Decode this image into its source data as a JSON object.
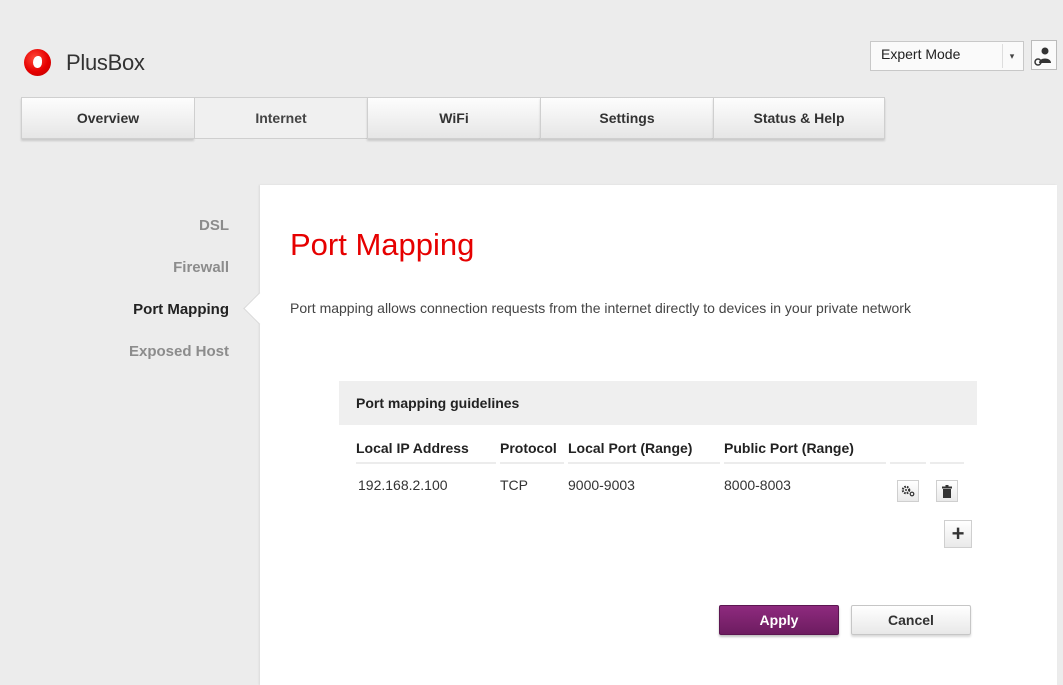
{
  "brand": {
    "name": "PlusBox",
    "accent": "#e60000"
  },
  "header": {
    "mode_select": {
      "value": "Expert Mode",
      "icon": "chevron-down-icon"
    },
    "user_button_icon": "user-icon"
  },
  "tabs": [
    {
      "label": "Overview",
      "active": false
    },
    {
      "label": "Internet",
      "active": true
    },
    {
      "label": "WiFi",
      "active": false
    },
    {
      "label": "Settings",
      "active": false
    },
    {
      "label": "Status & Help",
      "active": false
    }
  ],
  "subnav": [
    {
      "label": "DSL",
      "active": false
    },
    {
      "label": "Firewall",
      "active": false
    },
    {
      "label": "Port Mapping",
      "active": true
    },
    {
      "label": "Exposed Host",
      "active": false
    }
  ],
  "main": {
    "title": "Port Mapping",
    "description": "Port mapping allows connection requests from the internet directly to devices in your private network",
    "section_title": "Port mapping guidelines",
    "columns": [
      "Local IP Address",
      "Protocol",
      "Local Port (Range)",
      "Public Port (Range)"
    ],
    "rows": [
      {
        "local_ip": "192.168.2.100",
        "protocol": "TCP",
        "local_port": "9000-9003",
        "public_port": "8000-8003"
      }
    ],
    "row_actions": [
      "settings-gear-icon",
      "trash-icon"
    ],
    "add_icon": "plus-icon"
  },
  "actions": {
    "apply": "Apply",
    "cancel": "Cancel",
    "apply_color": "#7a2270"
  }
}
